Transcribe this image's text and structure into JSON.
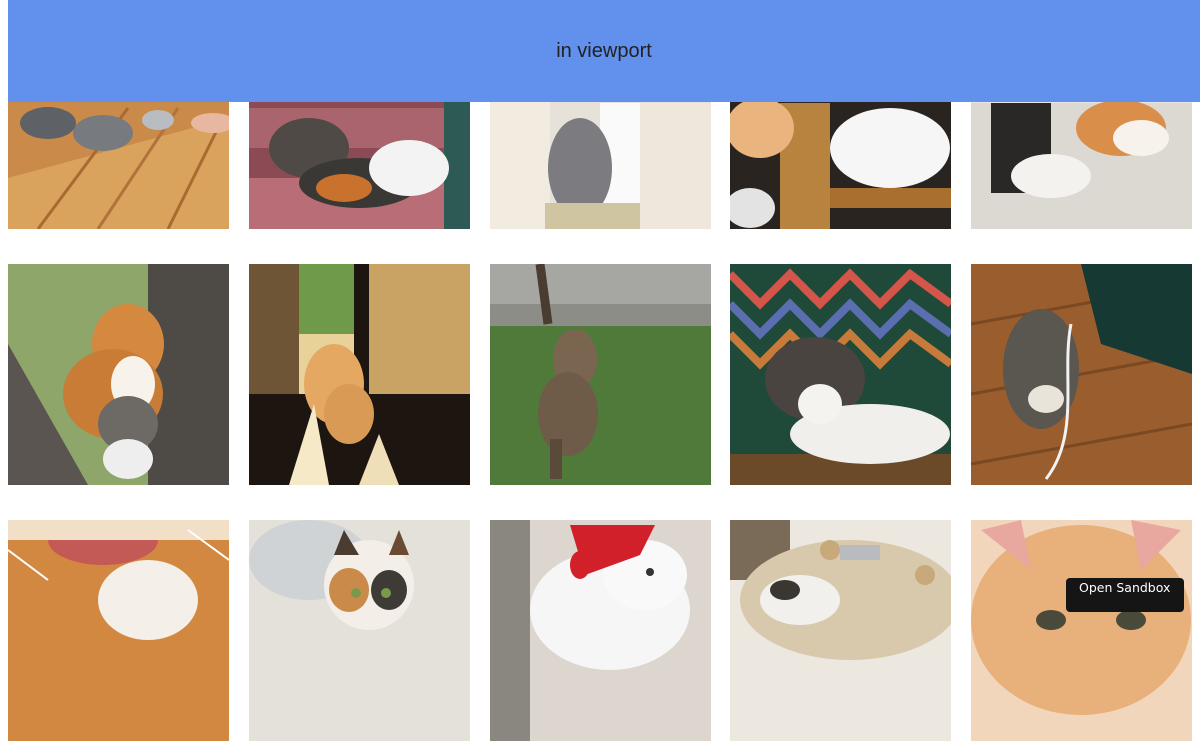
{
  "banner": {
    "text": "in viewport"
  },
  "gallery": {
    "images": [
      {
        "subject": "kittens-on-wood-floor"
      },
      {
        "subject": "cats-playing-on-stairs"
      },
      {
        "subject": "cat-by-window"
      },
      {
        "subject": "cat-sleeping-on-chair"
      },
      {
        "subject": "cat-paw-closeup"
      },
      {
        "subject": "kittens-in-tree"
      },
      {
        "subject": "cats-in-doorway"
      },
      {
        "subject": "cat-walking-on-grass"
      },
      {
        "subject": "cat-lying-on-rug"
      },
      {
        "subject": "cat-on-wood-floor"
      },
      {
        "subject": "cat-licking-paw"
      },
      {
        "subject": "calico-cat"
      },
      {
        "subject": "cat-in-santa-hat"
      },
      {
        "subject": "cat-in-sink"
      },
      {
        "subject": "kitten-face"
      }
    ]
  },
  "sandbox_button": {
    "label": "Open Sandbox"
  }
}
